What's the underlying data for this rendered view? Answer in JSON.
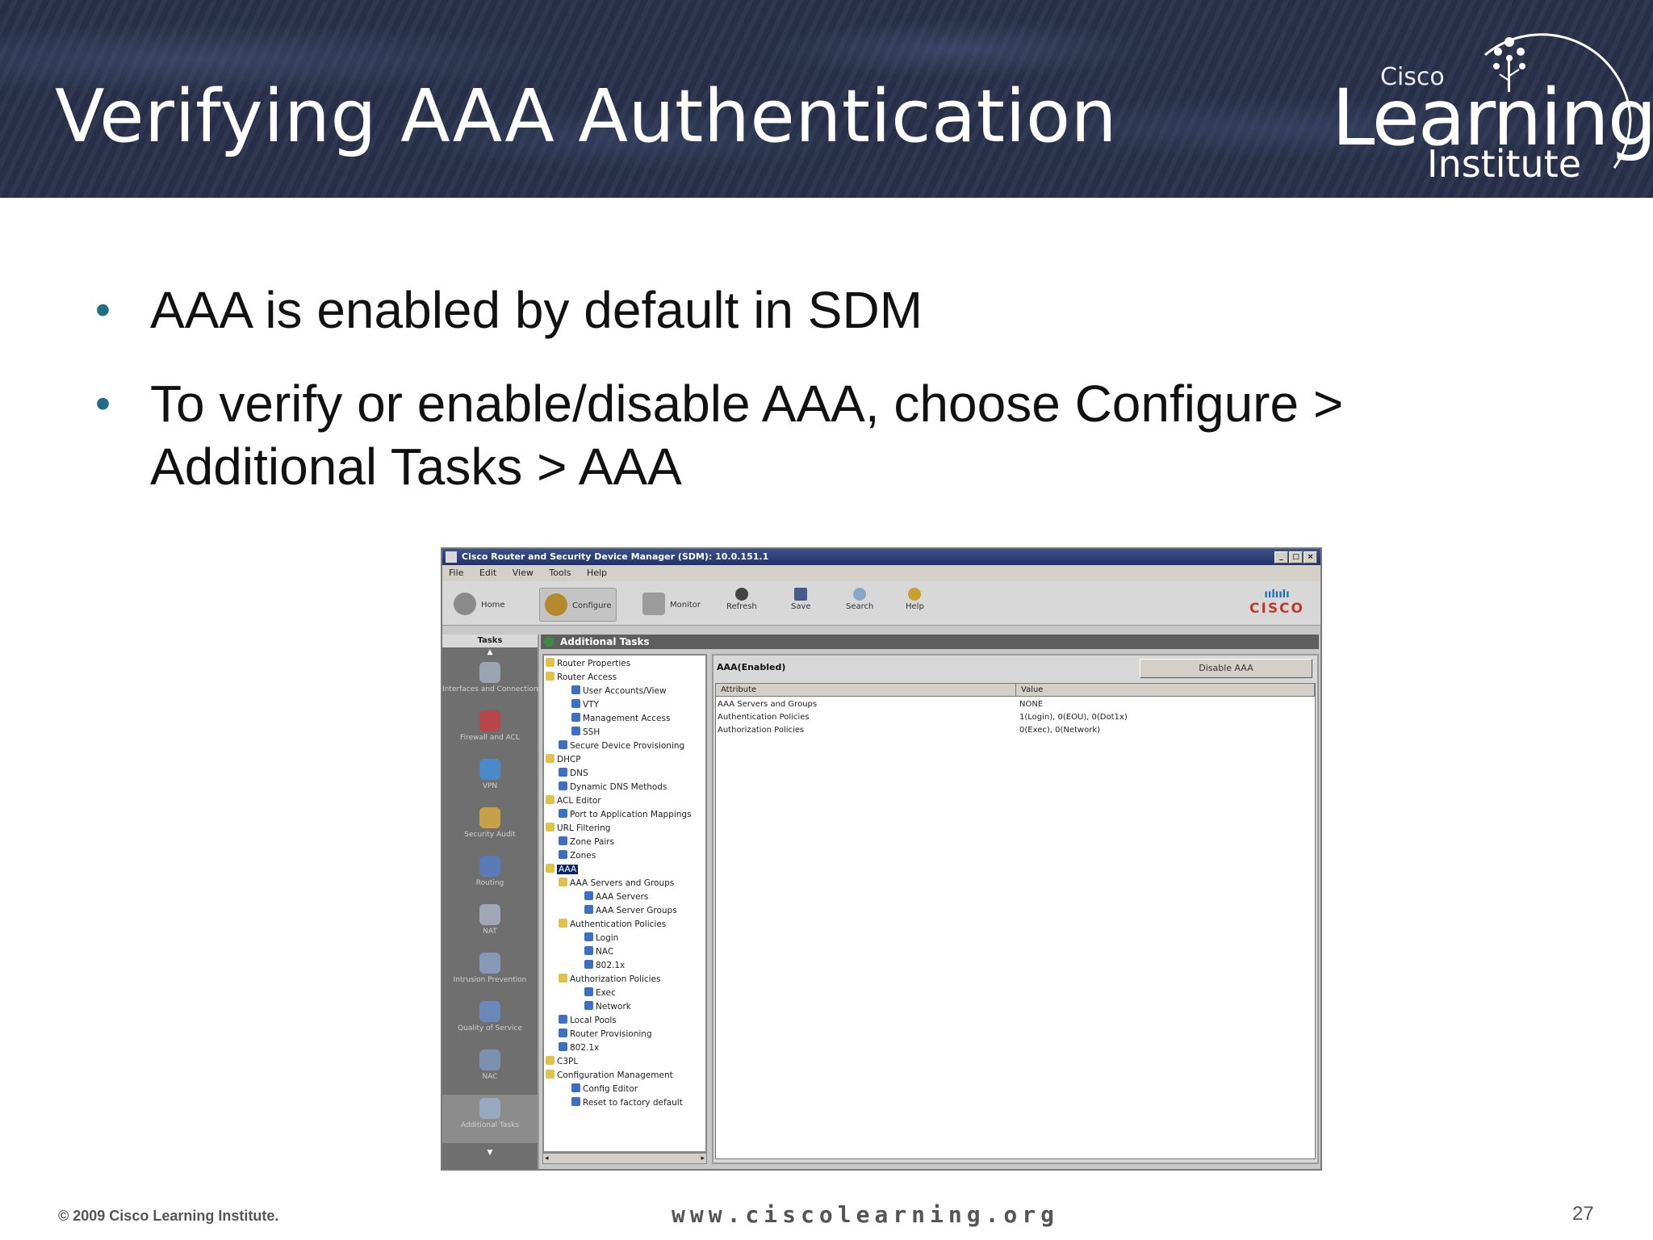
{
  "slide": {
    "title": "Verifying AAA Authentication",
    "logo": {
      "line1": "Cisco",
      "line2": "Learning",
      "line3": "Institute"
    },
    "bullets": [
      "AAA is enabled by default in SDM",
      "To verify or enable/disable AAA, choose Configure > Additional Tasks > AAA"
    ],
    "footer": {
      "copyright": "© 2009 Cisco Learning Institute.",
      "website": "www.ciscolearning.org",
      "page_number": "27"
    }
  },
  "sdm": {
    "window_title": "Cisco Router and Security Device Manager (SDM): 10.0.151.1",
    "menu": [
      "File",
      "Edit",
      "View",
      "Tools",
      "Help"
    ],
    "toolbar": {
      "home": "Home",
      "configure": "Configure",
      "monitor": "Monitor",
      "refresh": "Refresh",
      "save": "Save",
      "search": "Search",
      "help": "Help"
    },
    "brand": "CISCO",
    "tasks_header": "Tasks",
    "tasks": [
      "Interfaces and Connections",
      "Firewall and ACL",
      "VPN",
      "Security Audit",
      "Routing",
      "NAT",
      "Intrusion Prevention",
      "Quality of Service",
      "NAC",
      "Additional Tasks"
    ],
    "panel_title": "Additional Tasks",
    "tree": [
      "Router Properties",
      "Router Access",
      "User Accounts/View",
      "VTY",
      "Management Access",
      "SSH",
      "Secure Device Provisioning",
      "DHCP",
      "DNS",
      "Dynamic DNS Methods",
      "ACL Editor",
      "Port to Application Mappings",
      "URL Filtering",
      "Zone Pairs",
      "Zones",
      "AAA",
      "AAA Servers and Groups",
      "AAA Servers",
      "AAA Server Groups",
      "Authentication Policies",
      "Login",
      "NAC",
      "802.1x",
      "Authorization Policies",
      "Exec",
      "Network",
      "Local Pools",
      "Router Provisioning",
      "802.1x",
      "C3PL",
      "Configuration Management",
      "Config Editor",
      "Reset to factory default"
    ],
    "detail": {
      "status": "AAA(Enabled)",
      "disable_button": "Disable AAA",
      "columns": [
        "Attribute",
        "Value"
      ],
      "rows": [
        [
          "AAA Servers and Groups",
          "NONE"
        ],
        [
          "Authentication Policies",
          "1(Login), 0(EOU), 0(Dot1x)"
        ],
        [
          "Authorization Policies",
          "0(Exec), 0(Network)"
        ]
      ]
    }
  }
}
